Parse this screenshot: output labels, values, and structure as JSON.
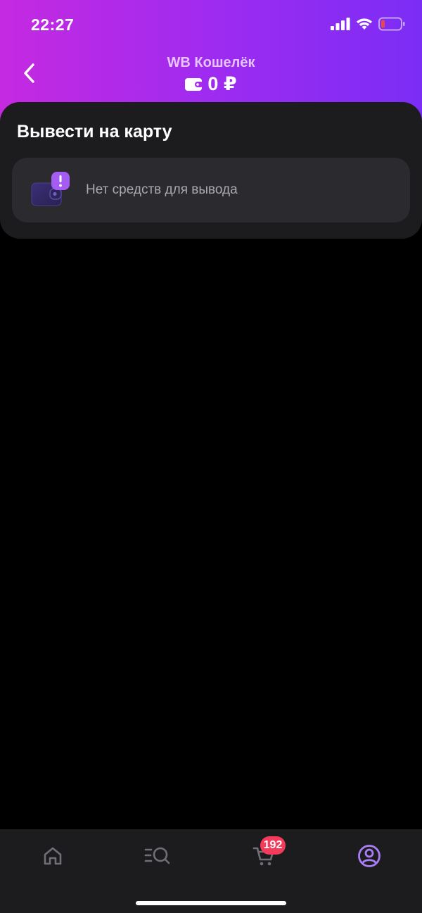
{
  "status_bar": {
    "time": "22:27",
    "icons": [
      "signal-icon",
      "wifi-icon",
      "battery-icon"
    ],
    "battery_color": "#e8484c"
  },
  "header": {
    "title": "WB Кошелёк",
    "balance": "0 ₽",
    "back_icon": "chevron-left-icon"
  },
  "withdraw": {
    "title": "Вывести на карту",
    "empty_message": "Нет средств для вывода",
    "icon": "wallet-warning-icon"
  },
  "nav": {
    "items": [
      {
        "name": "home",
        "icon": "home-icon"
      },
      {
        "name": "catalog",
        "icon": "catalog-search-icon"
      },
      {
        "name": "cart",
        "icon": "cart-icon",
        "badge": "192"
      },
      {
        "name": "profile",
        "icon": "profile-icon",
        "active": true
      }
    ],
    "active_color": "#a97ef5",
    "inactive_color": "#6f6f78",
    "badge_color": "#f43b5b"
  },
  "colors": {
    "gradient_start": "#c52ae0",
    "gradient_end": "#7b2df5",
    "card_bg": "#1c1c1f",
    "row_bg": "#2a2a2f"
  }
}
